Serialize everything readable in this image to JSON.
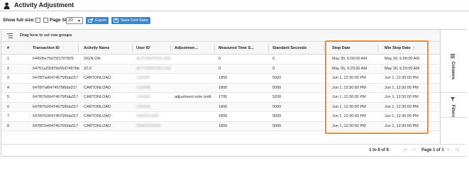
{
  "page": {
    "title": "Activity Adjustment",
    "title_icon": "user-icon"
  },
  "toolbar": {
    "show_full_size_label": "Show full size:",
    "page_size_label": "Page Size",
    "page_size_value": "20",
    "export_label": "Export",
    "save_grid_state_label": "Save Grid State",
    "button_color": "#3a86c8"
  },
  "grid": {
    "group_bar_text": "Drag here to set row groups",
    "columns": [
      "#",
      "Transaction ID",
      "Activity Name",
      "User ID",
      "Adjustmen...",
      "Measured Time S...",
      "Standard Seconds",
      "Stop Date",
      "Min Stop Date"
    ],
    "sorted_column": "Min Stop Date",
    "sort_direction": "ascending",
    "rows": [
      {
        "num": "1",
        "transaction_id": "64f605e75d75f1707876",
        "activity": "SIGN-ON",
        "user_id": "AUTOMATION.USE",
        "adjustment": "",
        "measured": "0",
        "standard": "0",
        "stop_date": "May 30, 6:00:00 AM",
        "min_stop_date": "May 30, 6:00:00 AM"
      },
      {
        "num": "2",
        "transaction_id": "64761a230f79e55d7497bb",
        "activity": "32.0",
        "user_id": "AUTOMATION.USE",
        "adjustment": "",
        "measured": "0",
        "standard": "0",
        "stop_date": "May 30, 6:20:00 AM",
        "min_stop_date": "May 30, 6:20:00 AM"
      },
      {
        "num": "3",
        "transaction_id": "6478f7ad6474675f0da317",
        "activity": "CARTONLOAD",
        "user_id": "CS0487",
        "adjustment": "",
        "measured": "1800",
        "standard": "5000",
        "stop_date": "Jun 1, 12:30:00 PM",
        "min_stop_date": "Jun 1, 12:30:00 PM"
      },
      {
        "num": "4",
        "transaction_id": "6478f7af6474675f0da317",
        "activity": "CARTONLOAD",
        "user_id": "CS0488",
        "adjustment": "",
        "measured": "1800",
        "standard": "5000",
        "stop_date": "Jun 1, 12:30:00 PM",
        "min_stop_date": "Jun 1, 12:30:00 PM"
      },
      {
        "num": "5",
        "transaction_id": "6478f7b06474675f0da317",
        "activity": "CARTONLOAD",
        "user_id": "CS0489",
        "adjustment": "adjustment note (edit",
        "measured": "1795",
        "standard": "5200",
        "stop_date": "Jun 1, 12:30:00 PM",
        "min_stop_date": "Jun 1, 12:30:00 PM"
      },
      {
        "num": "6",
        "transaction_id": "6478f7b26474675f0da317",
        "activity": "CARTONLOAD",
        "user_id": "CS0490",
        "adjustment": "",
        "measured": "1800",
        "standard": "5000",
        "stop_date": "Jun 1, 12:30:00 PM",
        "min_stop_date": "Jun 1, 12:30:00 PM"
      },
      {
        "num": "7",
        "transaction_id": "6478f7b36474675f0da317",
        "activity": "CARTONLOAD",
        "user_id": "DEMOUSER",
        "adjustment": "",
        "measured": "1800",
        "standard": "5000",
        "stop_date": "Jun 1, 12:30:00 PM",
        "min_stop_date": "Jun 1, 12:30:00 PM"
      },
      {
        "num": "8",
        "transaction_id": "6478f7b46474675f0da317",
        "activity": "CARTONLOAD",
        "user_id": "DEMOUSER2",
        "adjustment": "",
        "measured": "1800",
        "standard": "5000",
        "stop_date": "Jun 1, 12:30:00 PM",
        "min_stop_date": "Jun 1, 12:30:00 PM"
      }
    ]
  },
  "side_panel": {
    "columns_label": "Columns",
    "filters_label": "Filters"
  },
  "footer": {
    "row_range": "1 to 8 of 8",
    "page_text": "Page 1 of 1",
    "first_icon": "first-page-icon",
    "prev_icon": "prev-page-icon",
    "next_icon": "next-page-icon",
    "last_icon": "last-page-icon"
  },
  "colors": {
    "highlight": "#f28a2a",
    "accent": "#3a86c8"
  }
}
